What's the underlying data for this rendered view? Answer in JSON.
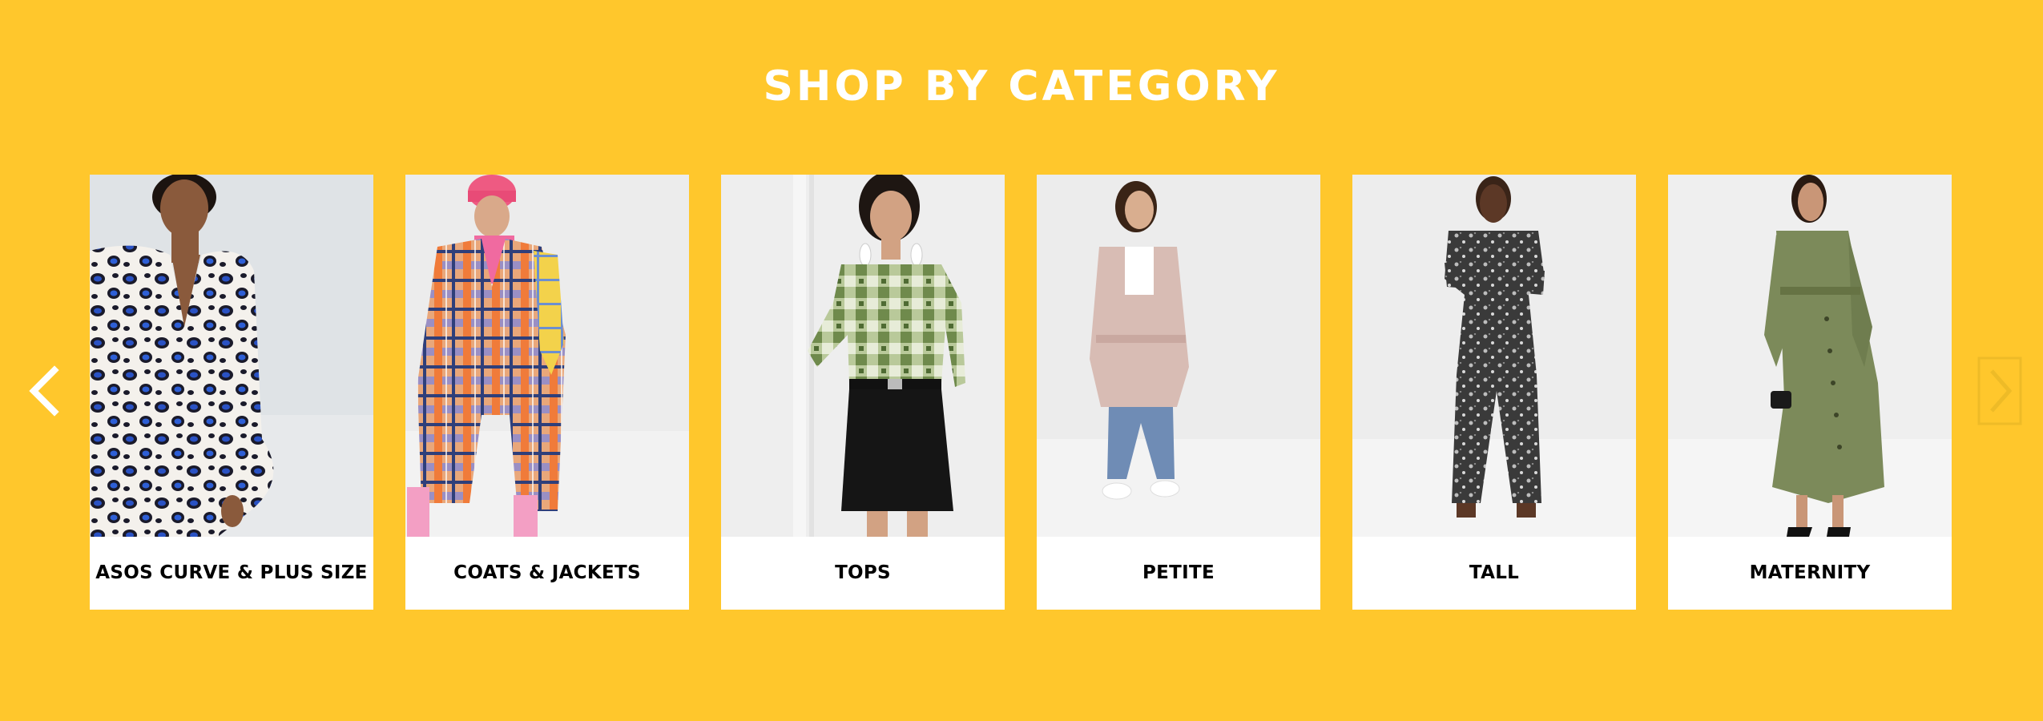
{
  "section": {
    "title": "SHOP BY CATEGORY",
    "background_color": "#FFC72C",
    "title_color": "#FFFFFF"
  },
  "carousel": {
    "prev_icon": "chevron-left-icon",
    "next_icon": "chevron-right-icon",
    "categories": [
      {
        "label": "ASOS CURVE & PLUS SIZE",
        "image": "model-leopard-print-wrap-dress"
      },
      {
        "label": "COATS & JACKETS",
        "image": "model-plaid-check-coat"
      },
      {
        "label": "TOPS",
        "image": "model-green-tie-dye-top"
      },
      {
        "label": "PETITE",
        "image": "model-pink-trench-coat"
      },
      {
        "label": "TALL",
        "image": "model-printed-jumpsuit"
      },
      {
        "label": "MATERNITY",
        "image": "model-khaki-shirt-dress"
      }
    ]
  }
}
